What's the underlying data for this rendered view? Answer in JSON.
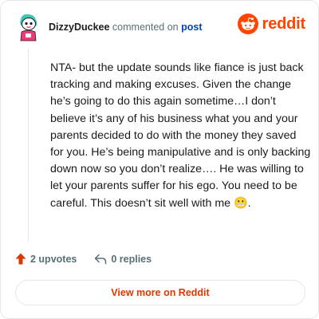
{
  "comment": {
    "author": "DizzyDuckee",
    "action_text": "commented on",
    "target": "post",
    "body": "NTA- but the update sounds like fiance is just back tracking and making excuses. Given the change he’s going to do this again sometime…I don’t believe it’s any of his business what you and your parents decided to do with the money they saved for you. He’s being manipulative and is only backing down now so you don’t realize…. He was willing to let your parents suffer for his ego. You need to be careful. This doesn’t sit well with me 😬."
  },
  "brand": {
    "name": "reddit",
    "color": "#ff4500"
  },
  "actions": {
    "upvotes": "2 upvotes",
    "replies": "0 replies"
  },
  "footer": {
    "view_more": "View more on Reddit"
  },
  "icons": {
    "avatar": "snoo-avatar-icon",
    "upvote": "upvote-arrow-icon",
    "reply": "reply-arrow-icon",
    "brand": "reddit-snoo-icon"
  }
}
